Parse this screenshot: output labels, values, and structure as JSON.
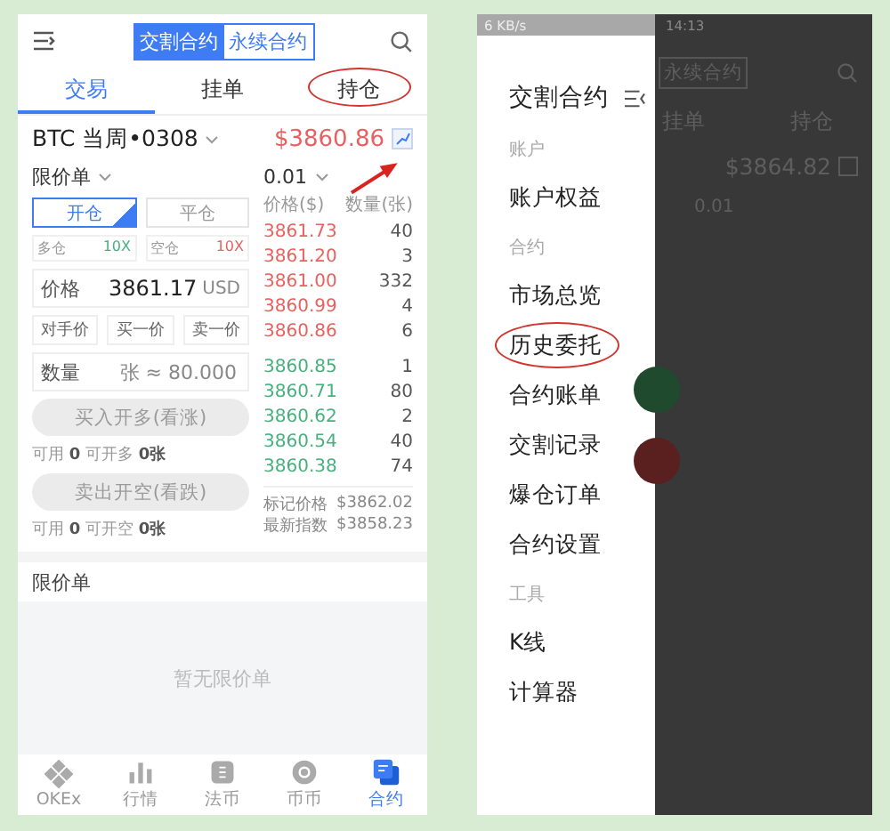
{
  "left_screen": {
    "header": {
      "segments": [
        {
          "label": "交割合约",
          "selected": true
        },
        {
          "label": "永续合约",
          "selected": false
        }
      ]
    },
    "tabs": [
      {
        "label": "交易",
        "selected": true,
        "circled": false
      },
      {
        "label": "挂单",
        "selected": false,
        "circled": false
      },
      {
        "label": "持仓",
        "selected": false,
        "circled": true
      }
    ],
    "ticker": {
      "symbol": "BTC 当周•0308",
      "price": "$3860.86",
      "arrow_to_chart": true
    },
    "order_form": {
      "order_type": "限价单",
      "modes": [
        {
          "label": "开仓",
          "selected": true
        },
        {
          "label": "平仓",
          "selected": false
        }
      ],
      "leverage": [
        {
          "label": "多仓",
          "value": "10X",
          "kind": "long"
        },
        {
          "label": "空仓",
          "value": "10X",
          "kind": "short"
        }
      ],
      "price": {
        "label": "价格",
        "value": "3861.17",
        "unit": "USD"
      },
      "price_shortcuts": [
        "对手价",
        "买一价",
        "卖一价"
      ],
      "amount": {
        "label": "数量",
        "placeholder": "张 ≈ 80.000"
      },
      "actions": [
        {
          "label": "买入开多(看涨)",
          "disabled": true,
          "availability": "可用 **0** 可开多 **0张**"
        },
        {
          "label": "卖出开空(看跌)",
          "disabled": true,
          "availability": "可用 **0** 可开空 **0张**"
        }
      ]
    },
    "order_book": {
      "step": "0.01",
      "columns": [
        "价格($)",
        "数量(张)"
      ],
      "rows": [
        {
          "kind": "ask",
          "price": "3861.73",
          "amount": "40"
        },
        {
          "kind": "ask",
          "price": "3861.20",
          "amount": "3"
        },
        {
          "kind": "ask",
          "price": "3861.00",
          "amount": "332"
        },
        {
          "kind": "ask",
          "price": "3860.99",
          "amount": "4"
        },
        {
          "kind": "ask",
          "price": "3860.86",
          "amount": "6"
        },
        {
          "kind": "bid",
          "price": "3860.85",
          "amount": "1"
        },
        {
          "kind": "bid",
          "price": "3860.71",
          "amount": "80"
        },
        {
          "kind": "bid",
          "price": "3860.62",
          "amount": "2"
        },
        {
          "kind": "bid",
          "price": "3860.54",
          "amount": "40"
        },
        {
          "kind": "bid",
          "price": "3860.38",
          "amount": "74"
        }
      ],
      "mark_price": {
        "label": "标记价格",
        "value": "$3862.02"
      },
      "index_price": {
        "label": "最新指数",
        "value": "$3858.23"
      }
    },
    "limit_orders": {
      "title": "限价单",
      "empty_text": "暂无限价单"
    },
    "bottom_nav": [
      {
        "label": "OKEx",
        "kind": "logo",
        "selected": false
      },
      {
        "label": "行情",
        "kind": "chart",
        "selected": false
      },
      {
        "label": "法币",
        "kind": "fiat",
        "selected": false
      },
      {
        "label": "币币",
        "kind": "coin",
        "selected": false
      },
      {
        "label": "合约",
        "kind": "contract",
        "selected": true
      }
    ]
  },
  "right_screen": {
    "status_bar": {
      "network_speed": "6 KB/s",
      "time": "14:13"
    },
    "drawer": {
      "items": [
        {
          "kind": "title",
          "label": "交割合约"
        },
        {
          "kind": "section",
          "label": "账户"
        },
        {
          "kind": "item",
          "label": "账户权益",
          "circled": false
        },
        {
          "kind": "section",
          "label": "合约"
        },
        {
          "kind": "item",
          "label": "市场总览",
          "circled": false
        },
        {
          "kind": "item",
          "label": "历史委托",
          "circled": true
        },
        {
          "kind": "item",
          "label": "合约账单",
          "circled": false
        },
        {
          "kind": "item",
          "label": "交割记录",
          "circled": false
        },
        {
          "kind": "item",
          "label": "爆仓订单",
          "circled": false
        },
        {
          "kind": "item",
          "label": "合约设置",
          "circled": false
        },
        {
          "kind": "section",
          "label": "工具"
        },
        {
          "kind": "item",
          "label": "K线",
          "circled": false
        },
        {
          "kind": "item",
          "label": "计算器",
          "circled": false
        }
      ]
    },
    "dimmed_screen": {
      "segment": "永续合约",
      "tabs": [
        "挂单",
        "持仓"
      ],
      "price": "$3864.82",
      "step": "0.01"
    }
  }
}
